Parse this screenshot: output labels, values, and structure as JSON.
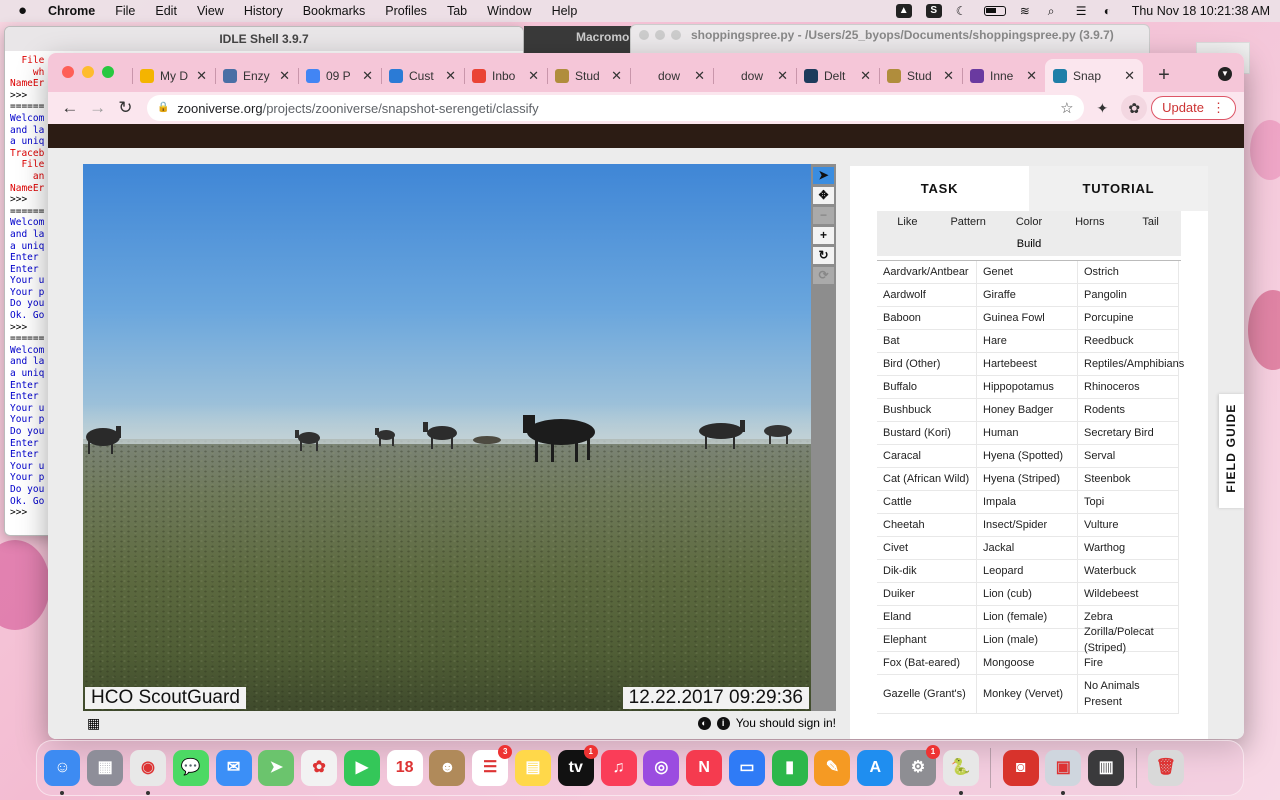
{
  "menubar": {
    "app_name": "Chrome",
    "items": [
      "File",
      "Edit",
      "View",
      "History",
      "Bookmarks",
      "Profiles",
      "Tab",
      "Window",
      "Help"
    ],
    "clock": "Thu Nov 18  10:21:38 AM"
  },
  "background_windows": {
    "idle_title": "IDLE Shell 3.9.7",
    "macro_title": "Macromo",
    "shopping_title": "shoppingspree.py - /Users/25_byops/Documents/shoppingspree.py (3.9.7)",
    "idle_lines": [
      {
        "text": "  File",
        "c": "r"
      },
      {
        "text": "    wh",
        "c": "r"
      },
      {
        "text": "NameEr",
        "c": "r"
      },
      {
        "text": ">>>",
        "c": "k"
      },
      {
        "text": "======",
        "c": "k"
      },
      {
        "text": "Welcom",
        "c": "b"
      },
      {
        "text": "and la",
        "c": "b"
      },
      {
        "text": "a uniq",
        "c": "b"
      },
      {
        "text": "Traceb",
        "c": "r"
      },
      {
        "text": "  File",
        "c": "r"
      },
      {
        "text": "    an",
        "c": "r"
      },
      {
        "text": "NameEr",
        "c": "r"
      },
      {
        "text": ">>>",
        "c": "k"
      },
      {
        "text": "======",
        "c": "k"
      },
      {
        "text": "Welcom",
        "c": "b"
      },
      {
        "text": "and la",
        "c": "b"
      },
      {
        "text": "a uniq",
        "c": "b"
      },
      {
        "text": "Enter ",
        "c": "b"
      },
      {
        "text": "Enter ",
        "c": "b"
      },
      {
        "text": "Your u",
        "c": "b"
      },
      {
        "text": "Your p",
        "c": "b"
      },
      {
        "text": "Do you",
        "c": "b"
      },
      {
        "text": "Ok. Go",
        "c": "b"
      },
      {
        "text": ">>>",
        "c": "k"
      },
      {
        "text": "======",
        "c": "k"
      },
      {
        "text": "Welcom",
        "c": "b"
      },
      {
        "text": "and la",
        "c": "b"
      },
      {
        "text": "a uniq",
        "c": "b"
      },
      {
        "text": "Enter ",
        "c": "b"
      },
      {
        "text": "Enter ",
        "c": "b"
      },
      {
        "text": "Your u",
        "c": "b"
      },
      {
        "text": "Your p",
        "c": "b"
      },
      {
        "text": "Do you",
        "c": "b"
      },
      {
        "text": "Enter ",
        "c": "b"
      },
      {
        "text": "Enter ",
        "c": "b"
      },
      {
        "text": "Your u",
        "c": "b"
      },
      {
        "text": "Your p",
        "c": "b"
      },
      {
        "text": "Do you",
        "c": "b"
      },
      {
        "text": "Ok. Go",
        "c": "b"
      },
      {
        "text": ">>>",
        "c": "k"
      }
    ]
  },
  "browser": {
    "tabs": [
      {
        "label": "My D",
        "icon": "drive-icon",
        "color": "#f4b400"
      },
      {
        "label": "Enzy",
        "icon": "book-icon",
        "color": "#4a6fa5"
      },
      {
        "label": "09 P",
        "icon": "docs-icon",
        "color": "#4285f4"
      },
      {
        "label": "Cust",
        "icon": "code-icon",
        "color": "#2b7bd6"
      },
      {
        "label": "Inbo",
        "icon": "gmail-icon",
        "color": "#ea4335"
      },
      {
        "label": "Stud",
        "icon": "school-seal-icon",
        "color": "#b08d3c"
      },
      {
        "label": "dow",
        "icon": "blank-icon",
        "color": "#f5c6d8"
      },
      {
        "label": "dow",
        "icon": "blank-icon",
        "color": "#f5c6d8"
      },
      {
        "label": "Delt",
        "icon": "cap-icon",
        "color": "#1d3b5c"
      },
      {
        "label": "Stud",
        "icon": "school-seal-icon",
        "color": "#b08d3c"
      },
      {
        "label": "Inne",
        "icon": "dots-icon",
        "color": "#6a3aa0"
      },
      {
        "label": "Snap",
        "icon": "zooniverse-icon",
        "color": "#1f7fa8"
      }
    ],
    "url_host": "zooniverse.org",
    "url_path": "/projects/zooniverse/snapshot-serengeti/classify",
    "update_label": "Update"
  },
  "viewer": {
    "camera_label": "HCO ScoutGuard",
    "timestamp": "12.22.2017 09:29:36",
    "signin_text": "You should sign in!"
  },
  "task_panel": {
    "tab_task": "TASK",
    "tab_tutorial": "TUTORIAL",
    "filters": [
      "Like",
      "Pattern",
      "Color",
      "Horns",
      "Tail"
    ],
    "filter_build": "Build",
    "species": [
      "Aardvark/Antbear",
      "Genet",
      "Ostrich",
      "Aardwolf",
      "Giraffe",
      "Pangolin",
      "Baboon",
      "Guinea Fowl",
      "Porcupine",
      "Bat",
      "Hare",
      "Reedbuck",
      "Bird (Other)",
      "Hartebeest",
      "Reptiles/Amphibians",
      "Buffalo",
      "Hippopotamus",
      "Rhinoceros",
      "Bushbuck",
      "Honey Badger",
      "Rodents",
      "Bustard (Kori)",
      "Human",
      "Secretary Bird",
      "Caracal",
      "Hyena (Spotted)",
      "Serval",
      "Cat (African Wild)",
      "Hyena (Striped)",
      "Steenbok",
      "Cattle",
      "Impala",
      "Topi",
      "Cheetah",
      "Insect/Spider",
      "Vulture",
      "Civet",
      "Jackal",
      "Warthog",
      "Dik-dik",
      "Leopard",
      "Waterbuck",
      "Duiker",
      "Lion (cub)",
      "Wildebeest",
      "Eland",
      "Lion (female)",
      "Zebra",
      "Elephant",
      "Lion (male)",
      "Zorilla/Polecat (Striped)",
      "Fox (Bat-eared)",
      "Mongoose",
      "Fire",
      "Gazelle (Grant's)",
      "Monkey (Vervet)",
      "No Animals Present"
    ],
    "field_guide": "FIELD GUIDE"
  },
  "dock": {
    "apps": [
      {
        "name": "finder-icon",
        "color": "#3d8bf2",
        "glyph": "☺",
        "running": true
      },
      {
        "name": "launchpad-icon",
        "color": "#8e8e99",
        "glyph": "▦"
      },
      {
        "name": "chrome-icon",
        "color": "#e8e8e8",
        "glyph": "◉",
        "running": true
      },
      {
        "name": "messages-icon",
        "color": "#4cd964",
        "glyph": "💬"
      },
      {
        "name": "mail-icon",
        "color": "#3b8ff7",
        "glyph": "✉"
      },
      {
        "name": "maps-icon",
        "color": "#6bc46d",
        "glyph": "➤"
      },
      {
        "name": "photos-icon",
        "color": "#f2f2f2",
        "glyph": "✿"
      },
      {
        "name": "facetime-icon",
        "color": "#34c759",
        "glyph": "▶"
      },
      {
        "name": "calendar-icon",
        "color": "#ffffff",
        "glyph": "18"
      },
      {
        "name": "contacts-icon",
        "color": "#b08a5a",
        "glyph": "☻"
      },
      {
        "name": "reminders-icon",
        "color": "#ffffff",
        "glyph": "☰",
        "badge": "3"
      },
      {
        "name": "notes-icon",
        "color": "#ffd84a",
        "glyph": "▤"
      },
      {
        "name": "tv-icon",
        "color": "#111111",
        "glyph": "tv",
        "badge": "1"
      },
      {
        "name": "music-icon",
        "color": "#fa3d58",
        "glyph": "♫"
      },
      {
        "name": "podcasts-icon",
        "color": "#9b4ce0",
        "glyph": "◎"
      },
      {
        "name": "news-icon",
        "color": "#f53b4f",
        "glyph": "N"
      },
      {
        "name": "keynote-icon",
        "color": "#2f7bf6",
        "glyph": "▭"
      },
      {
        "name": "numbers-icon",
        "color": "#2db74a",
        "glyph": "▮"
      },
      {
        "name": "pages-icon",
        "color": "#f59a23",
        "glyph": "✎"
      },
      {
        "name": "appstore-icon",
        "color": "#1f8ef0",
        "glyph": "A"
      },
      {
        "name": "settings-icon",
        "color": "#8e8e93",
        "glyph": "⚙",
        "badge": "1"
      },
      {
        "name": "python-icon",
        "color": "#e7e7e7",
        "glyph": "🐍",
        "running": true
      },
      {
        "name": "photobooth-icon",
        "color": "#d8332c",
        "glyph": "◙",
        "sep_before": true
      },
      {
        "name": "preview-icon",
        "color": "#cfd6de",
        "glyph": "▣",
        "running": true
      },
      {
        "name": "calculator-icon",
        "color": "#3a3a3c",
        "glyph": "▥"
      },
      {
        "name": "trash-icon",
        "color": "#d9d9d9",
        "glyph": "🗑",
        "sep_before": true
      }
    ]
  }
}
